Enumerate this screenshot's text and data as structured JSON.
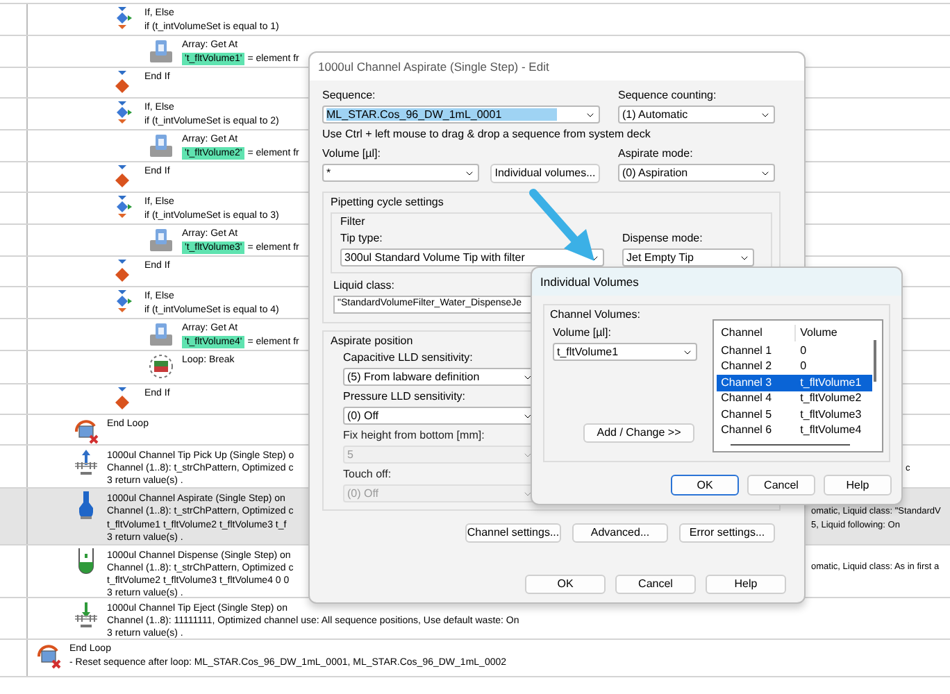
{
  "tree": {
    "steps": [
      {
        "kind": "block",
        "children": [
          {
            "kind": "block",
            "children": [
              {
                "kind": "if",
                "selected": false,
                "lines": [
                  {
                    "text": "If, Else"
                  },
                  {
                    "text": "if (t_intVolumeSet is equal to 1)"
                  }
                ],
                "children": [
                  {
                    "kind": "array",
                    "selected": false,
                    "lines": [
                      {
                        "text": "Array: Get At"
                      },
                      {
                        "tag": "'t_fltVolume1'",
                        "text": "= element fr"
                      }
                    ]
                  }
                ]
              },
              {
                "kind": "end_if",
                "selected": false,
                "lines": [
                  {
                    "text": "End If"
                  }
                ]
              },
              {
                "kind": "if",
                "selected": false,
                "lines": [
                  {
                    "text": "If, Else"
                  },
                  {
                    "text": "if (t_intVolumeSet is equal to 2)"
                  }
                ],
                "children": [
                  {
                    "kind": "array",
                    "selected": false,
                    "lines": [
                      {
                        "text": "Array: Get At"
                      },
                      {
                        "tag": "'t_fltVolume2'",
                        "text": "= element fr"
                      }
                    ]
                  }
                ]
              },
              {
                "kind": "end_if",
                "selected": false,
                "lines": [
                  {
                    "text": "End If"
                  }
                ]
              },
              {
                "kind": "if",
                "selected": false,
                "lines": [
                  {
                    "text": "If, Else"
                  },
                  {
                    "text": "if (t_intVolumeSet is equal to 3)"
                  }
                ],
                "children": [
                  {
                    "kind": "array",
                    "selected": false,
                    "lines": [
                      {
                        "text": "Array: Get At"
                      },
                      {
                        "tag": "'t_fltVolume3'",
                        "text": "= element fr"
                      }
                    ]
                  }
                ]
              },
              {
                "kind": "end_if",
                "selected": false,
                "lines": [
                  {
                    "text": "End If"
                  }
                ]
              },
              {
                "kind": "if",
                "selected": false,
                "lines": [
                  {
                    "text": "If, Else"
                  },
                  {
                    "text": "if (t_intVolumeSet is equal to 4)"
                  }
                ],
                "children": [
                  {
                    "kind": "array",
                    "selected": false,
                    "lines": [
                      {
                        "text": "Array: Get At"
                      },
                      {
                        "tag": "'t_fltVolume4'",
                        "text": "= element fr"
                      }
                    ]
                  },
                  {
                    "kind": "break",
                    "selected": false,
                    "lines": [
                      {
                        "text": "Loop: Break"
                      }
                    ]
                  }
                ]
              },
              {
                "kind": "end_if",
                "selected": false,
                "lines": [
                  {
                    "text": "End If"
                  }
                ]
              }
            ]
          },
          {
            "kind": "end_loop",
            "selected": false,
            "lines": [
              {
                "text": "End Loop"
              }
            ]
          },
          {
            "kind": "pick_up",
            "selected": false,
            "lines": [
              {
                "text": "1000ul Channel Tip Pick Up (Single Step) o"
              },
              {
                "text": "Channel (1..8): t_strChPattern, Optimized c",
                "right": "c"
              },
              {
                "text": "3 return value(s) ."
              }
            ]
          },
          {
            "kind": "aspirate",
            "selected": true,
            "lines": [
              {
                "text": "1000ul Channel Aspirate (Single Step) on"
              },
              {
                "text": "Channel (1..8): t_strChPattern, Optimized c",
                "right": "omatic, Liquid class: \"StandardV"
              },
              {
                "text": "t_fltVolume1 t_fltVolume2 t_fltVolume3 t_f",
                "right": "5, Liquid following: On"
              },
              {
                "text": "3 return value(s) ."
              }
            ]
          },
          {
            "kind": "dispense",
            "selected": false,
            "lines": [
              {
                "text": "1000ul Channel Dispense (Single Step) on"
              },
              {
                "text": "Channel (1..8): t_strChPattern, Optimized c",
                "right": "omatic, Liquid class: As in first a"
              },
              {
                "text": "t_fltVolume2 t_fltVolume3 t_fltVolume4 0 0"
              },
              {
                "text": "3 return value(s) ."
              }
            ]
          },
          {
            "kind": "eject",
            "selected": false,
            "lines": [
              {
                "text": "1000ul Channel Tip Eject (Single Step) on"
              },
              {
                "text": "Channel (1..8): 11111111, Optimized channel use: All sequence positions, Use default waste: On"
              },
              {
                "text": "3 return value(s) ."
              }
            ]
          }
        ]
      },
      {
        "kind": "end_loop",
        "selected": false,
        "lines": [
          {
            "text": "End Loop"
          },
          {
            "text": "- Reset sequence after loop: ML_STAR.Cos_96_DW_1mL_0001,  ML_STAR.Cos_96_DW_1mL_0002"
          }
        ]
      }
    ]
  },
  "aspirate_dialog": {
    "title": "1000ul Channel Aspirate (Single Step) - Edit",
    "sequence": {
      "label": "Sequence:",
      "value": "ML_STAR.Cos_96_DW_1mL_0001",
      "selected": true
    },
    "sequence_counting": {
      "label": "Sequence counting:",
      "value": "(1) Automatic"
    },
    "hint": "Use Ctrl + left mouse to drag & drop a sequence from system deck",
    "volume": {
      "label": "Volume [µl]:",
      "value": "*"
    },
    "individual_volumes_button": "Individual volumes...",
    "aspirate_mode": {
      "label": "Aspirate mode:",
      "value": "(0) Aspiration"
    },
    "pipetting_cycle": {
      "title": "Pipetting cycle settings",
      "filter": {
        "title": "Filter",
        "tip_type": {
          "label": "Tip type:",
          "value": "300ul Standard Volume Tip with filter"
        },
        "dispense_mode": {
          "label": "Dispense mode:",
          "value": "Jet Empty Tip"
        }
      },
      "liquid_class": {
        "label": "Liquid class:",
        "value": "\"StandardVolumeFilter_Water_DispenseJe"
      }
    },
    "aspirate_position": {
      "title": "Aspirate position",
      "fields": [
        {
          "label": "Capacitive LLD sensitivity:",
          "value": "(5) From labware definition",
          "disabled": false
        },
        {
          "label": "Pressure LLD sensitivity:",
          "value": "(0) Off",
          "disabled": false
        },
        {
          "label": "Fix height from bottom [mm]:",
          "value": "5",
          "disabled": true
        },
        {
          "label": "Touch off:",
          "value": "(0) Off",
          "disabled": true
        }
      ]
    },
    "buttons": [
      "Channel settings...",
      "Advanced...",
      "Error settings..."
    ],
    "footer_buttons": [
      "OK",
      "Cancel",
      "Help"
    ]
  },
  "volumes_dialog": {
    "title": "Individual Volumes",
    "group": "Channel Volumes:",
    "volume": {
      "label": "Volume [µl]:",
      "value": "t_fltVolume1"
    },
    "add_button": "Add / Change  >>",
    "list": {
      "columns": [
        "Channel",
        "Volume"
      ],
      "rows": [
        {
          "cells": [
            "Channel 1",
            "0"
          ],
          "selected": false
        },
        {
          "cells": [
            "Channel 2",
            "0"
          ],
          "selected": false
        },
        {
          "cells": [
            "Channel 3",
            "t_fltVolume1"
          ],
          "selected": true
        },
        {
          "cells": [
            "Channel 4",
            "t_fltVolume2"
          ],
          "selected": false
        },
        {
          "cells": [
            "Channel 5",
            "t_fltVolume3"
          ],
          "selected": false
        },
        {
          "cells": [
            "Channel 6",
            "t_fltVolume4"
          ],
          "selected": false
        }
      ]
    },
    "buttons": [
      {
        "label": "OK",
        "default": true
      },
      {
        "label": "Cancel",
        "default": false
      },
      {
        "label": "Help",
        "default": false
      }
    ]
  }
}
